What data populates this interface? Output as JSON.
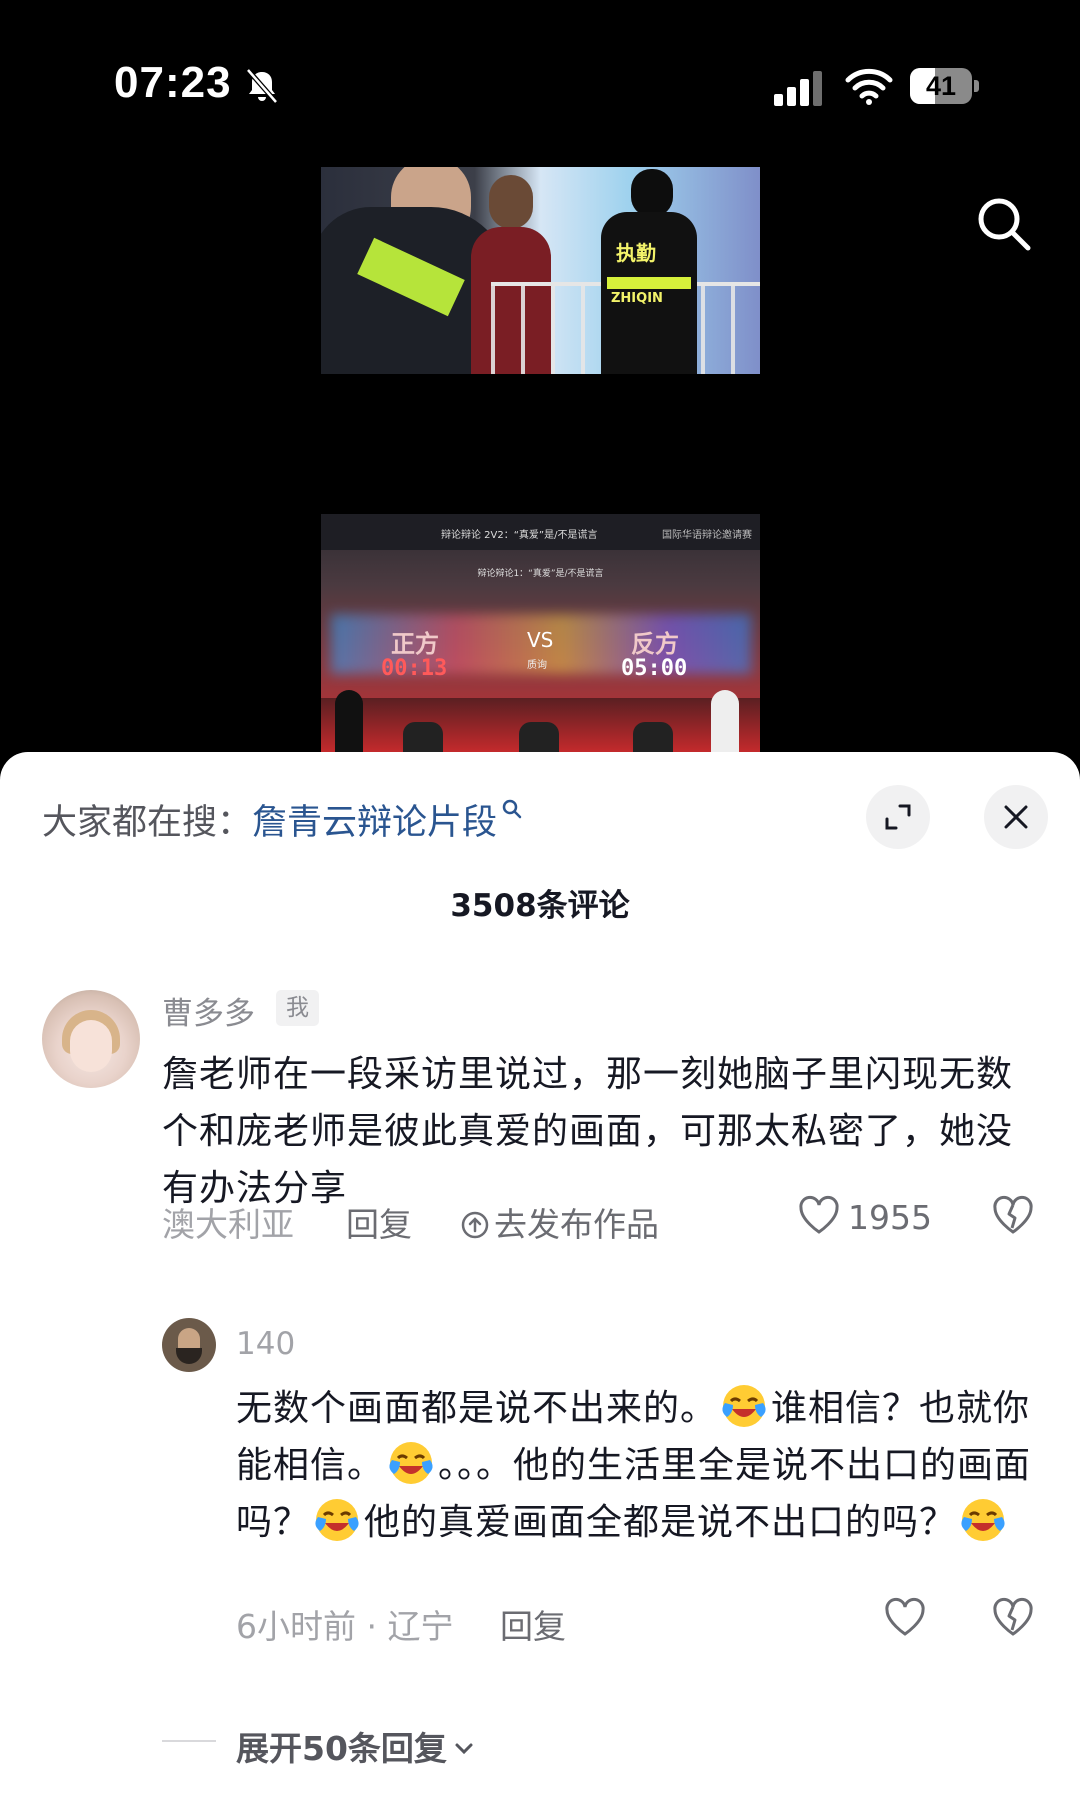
{
  "status_bar": {
    "time": "07:23",
    "battery": "41",
    "battery_level": 0.41,
    "icons": [
      "bell-muted-icon",
      "signal-icon",
      "wifi-icon",
      "battery-icon"
    ]
  },
  "video": {
    "frame1": {
      "vest_label": "执勤",
      "vest_sublabel": "ZHIQIN"
    },
    "frame2": {
      "top_left": "辩论辩论 2V2：“真爱”是/不是谎言",
      "top_right": "国际华语辩论邀请赛",
      "subtitle": "辩论辩论1：“真爱”是/不是谎言",
      "left_side": "正方",
      "left_timer": "00:13",
      "vs": "VS",
      "vs_sub": "质询",
      "right_side": "反方",
      "right_timer": "05:00"
    }
  },
  "sheet": {
    "everyone_prefix": "大家都在搜：",
    "everyone_keyword": "詹青云辩论片段",
    "count_label": "3508条评论"
  },
  "comments": [
    {
      "author": "曹多多",
      "badge": "我",
      "text": "詹老师在一段采访里说过，那一刻她脑子里闪现无数个和庞老师是彼此真爱的画面，可那太私密了，她没有办法分享",
      "location": "澳大利亚",
      "reply_label": "回复",
      "publish_label": "去发布作品",
      "likes": "1955"
    }
  ],
  "reply": {
    "author": "140",
    "segments": [
      "无数个画面都是说不出来的。",
      "谁相信？也就你能相信。",
      "。。。他的生活里全是说不出口的画面吗？",
      "他的真爱画面全都是说不出口的吗？",
      ""
    ],
    "meta": "6小时前 · 辽宁",
    "reply_label": "回复"
  },
  "expand_replies": "展开50条回复",
  "colors": {
    "keyword": "#2a5590",
    "text": "#161823",
    "muted": "#a2a3a8"
  }
}
